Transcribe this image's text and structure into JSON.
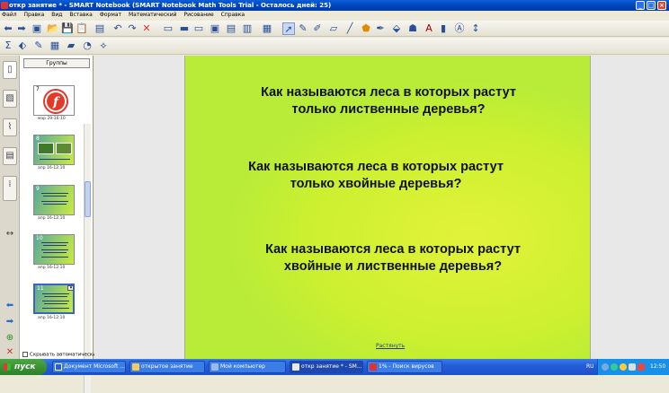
{
  "window": {
    "title": "откр занятие * - SMART Notebook (SMART Notebook Math Tools Trial - Осталось дней: 25)"
  },
  "menu": [
    "Файл",
    "Правка",
    "Вид",
    "Вставка",
    "Формат",
    "Математический",
    "Рисование",
    "Справка"
  ],
  "sorter": {
    "groups_label": "Группы",
    "thumbs": [
      {
        "num": "7",
        "date": "мар 29-16:10"
      },
      {
        "num": "8",
        "date": "апр 16-12:10"
      },
      {
        "num": "9",
        "date": "апр 16-12:10"
      },
      {
        "num": "10",
        "date": "апр 16-12:10"
      },
      {
        "num": "11",
        "date": "апр 16-12:10"
      }
    ],
    "autohide_label": "Скрывать автоматически"
  },
  "slide": {
    "q1_line1": "Как называются леса в которых растут",
    "q1_line2": "только лиственные деревья?",
    "q2_line1": "Как называются леса в которых растут",
    "q2_line2": "только хвойные деревья?",
    "q3_line1": "Как называются леса в которых растут",
    "q3_line2": "хвойные и лиственные деревья?",
    "stretch_link": "Растянуть"
  },
  "taskbar": {
    "start": "пуск",
    "tasks": [
      "Документ Microsoft ...",
      "открытое занятие",
      "Мой компьютер",
      "откр занятие * - SM...",
      "1% - Поиск вирусов"
    ],
    "lang": "RU",
    "clock": "12:50"
  },
  "colors": {
    "titlebar": "#0a5fd8",
    "slide_green": "#ccf02f",
    "taskbar": "#245edb",
    "start": "#3b9434"
  }
}
